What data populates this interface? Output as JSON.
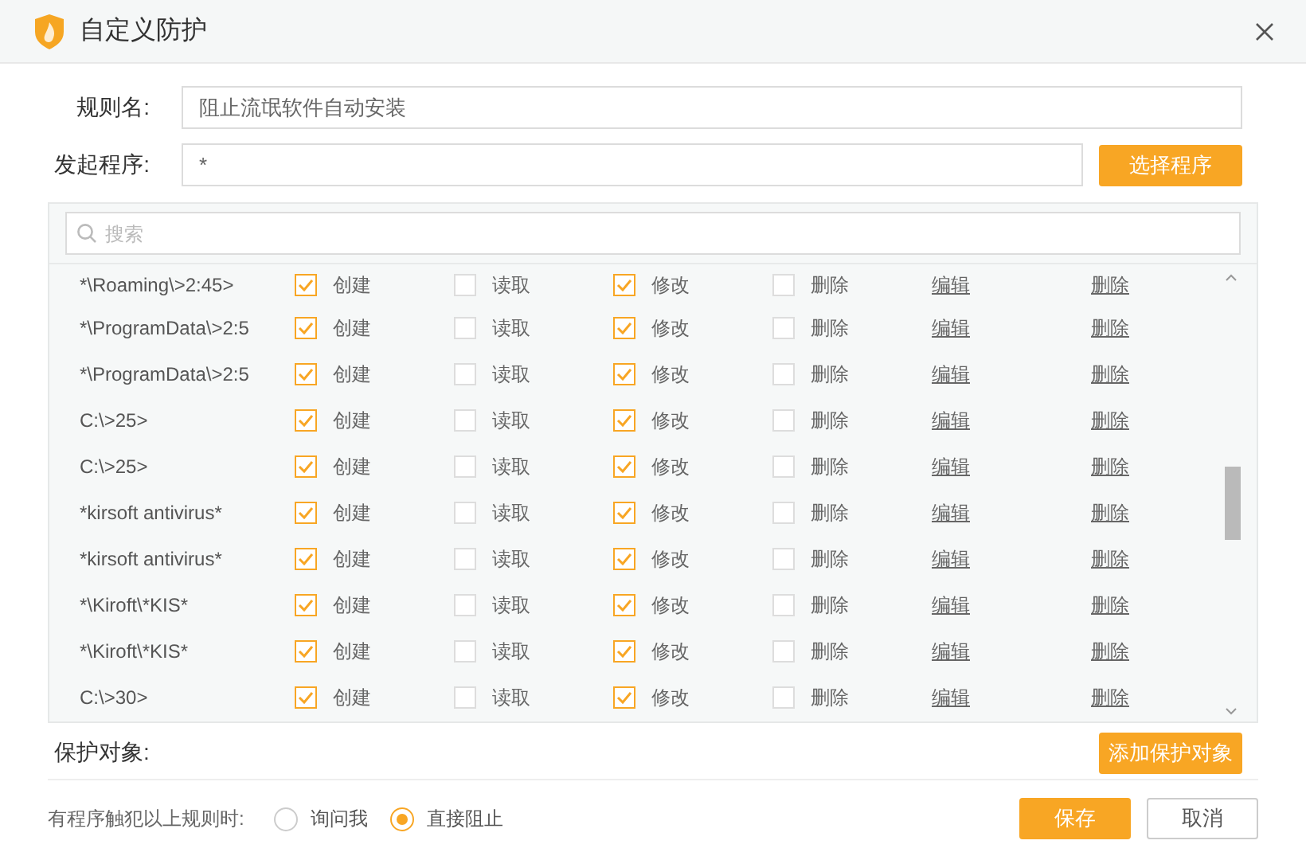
{
  "window": {
    "title": "自定义防护"
  },
  "rule_name": {
    "label": "规则名:",
    "value": "阻止流氓软件自动安装"
  },
  "program": {
    "label": "发起程序:",
    "value": "*",
    "button": "选择程序"
  },
  "search": {
    "placeholder": "搜索"
  },
  "rows": [
    {
      "path": "*\\Roaming\\>2:45>",
      "permissions": [
        {
          "label": "创建",
          "checked": true
        },
        {
          "label": "读取",
          "checked": false
        },
        {
          "label": "修改",
          "checked": true
        },
        {
          "label": "删除",
          "checked": false
        }
      ],
      "links": [
        "编辑",
        "删除"
      ]
    },
    {
      "path": "*\\ProgramData\\>2:5",
      "permissions": [
        {
          "label": "创建",
          "checked": true
        },
        {
          "label": "读取",
          "checked": false
        },
        {
          "label": "修改",
          "checked": true
        },
        {
          "label": "删除",
          "checked": false
        }
      ],
      "links": [
        "编辑",
        "删除"
      ]
    },
    {
      "path": "*\\ProgramData\\>2:5",
      "permissions": [
        {
          "label": "创建",
          "checked": true
        },
        {
          "label": "读取",
          "checked": false
        },
        {
          "label": "修改",
          "checked": true
        },
        {
          "label": "删除",
          "checked": false
        }
      ],
      "links": [
        "编辑",
        "删除"
      ]
    },
    {
      "path": "C:\\>25>",
      "permissions": [
        {
          "label": "创建",
          "checked": true
        },
        {
          "label": "读取",
          "checked": false
        },
        {
          "label": "修改",
          "checked": true
        },
        {
          "label": "删除",
          "checked": false
        }
      ],
      "links": [
        "编辑",
        "删除"
      ]
    },
    {
      "path": "C:\\>25>",
      "permissions": [
        {
          "label": "创建",
          "checked": true
        },
        {
          "label": "读取",
          "checked": false
        },
        {
          "label": "修改",
          "checked": true
        },
        {
          "label": "删除",
          "checked": false
        }
      ],
      "links": [
        "编辑",
        "删除"
      ]
    },
    {
      "path": "*kirsoft antivirus*",
      "permissions": [
        {
          "label": "创建",
          "checked": true
        },
        {
          "label": "读取",
          "checked": false
        },
        {
          "label": "修改",
          "checked": true
        },
        {
          "label": "删除",
          "checked": false
        }
      ],
      "links": [
        "编辑",
        "删除"
      ]
    },
    {
      "path": "*kirsoft antivirus*",
      "permissions": [
        {
          "label": "创建",
          "checked": true
        },
        {
          "label": "读取",
          "checked": false
        },
        {
          "label": "修改",
          "checked": true
        },
        {
          "label": "删除",
          "checked": false
        }
      ],
      "links": [
        "编辑",
        "删除"
      ]
    },
    {
      "path": "*\\Kiroft\\*KIS*",
      "permissions": [
        {
          "label": "创建",
          "checked": true
        },
        {
          "label": "读取",
          "checked": false
        },
        {
          "label": "修改",
          "checked": true
        },
        {
          "label": "删除",
          "checked": false
        }
      ],
      "links": [
        "编辑",
        "删除"
      ]
    },
    {
      "path": "*\\Kiroft\\*KIS*",
      "permissions": [
        {
          "label": "创建",
          "checked": true
        },
        {
          "label": "读取",
          "checked": false
        },
        {
          "label": "修改",
          "checked": true
        },
        {
          "label": "删除",
          "checked": false
        }
      ],
      "links": [
        "编辑",
        "删除"
      ]
    },
    {
      "path": "C:\\>30>",
      "permissions": [
        {
          "label": "创建",
          "checked": true
        },
        {
          "label": "读取",
          "checked": false
        },
        {
          "label": "修改",
          "checked": true
        },
        {
          "label": "删除",
          "checked": false
        }
      ],
      "links": [
        "编辑",
        "删除"
      ]
    }
  ],
  "protect": {
    "label": "保护对象:",
    "button": "添加保护对象"
  },
  "footer": {
    "label": "有程序触犯以上规则时:",
    "options": [
      {
        "label": "询问我",
        "selected": false
      },
      {
        "label": "直接阻止",
        "selected": true
      }
    ],
    "save": "保存",
    "cancel": "取消"
  }
}
